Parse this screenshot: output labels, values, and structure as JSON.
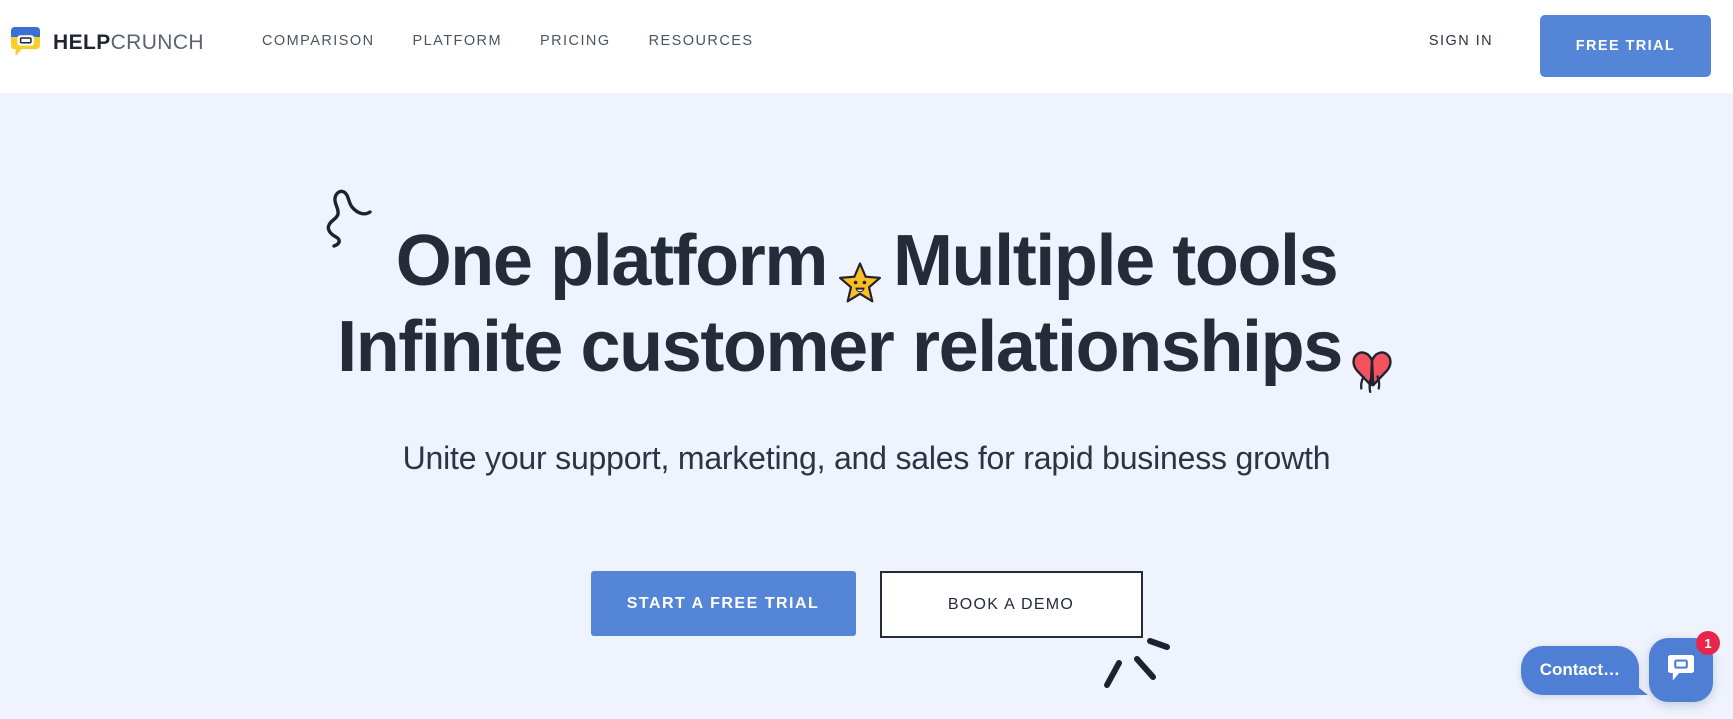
{
  "colors": {
    "accent_blue": "#5585d6",
    "chat_blue": "#4f7fd4",
    "badge_red": "#e8264b",
    "hero_bg": "#eff3fd",
    "header_bg": "#ffffff",
    "heading_dark": "#242c3a",
    "logo_blue": "#3b6fd4",
    "logo_yellow": "#f5cf2e",
    "star_yellow": "#fbbf24",
    "heart_red": "#f4525f"
  },
  "header": {
    "logo": {
      "icon": "speech-bubble-logo-icon",
      "text_bold": "HELP",
      "text_light": "CRUNCH"
    },
    "nav_items": [
      {
        "label": "COMPARISON",
        "name": "nav-item-comparison"
      },
      {
        "label": "PLATFORM",
        "name": "nav-item-platform"
      },
      {
        "label": "PRICING",
        "name": "nav-item-pricing"
      },
      {
        "label": "RESOURCES",
        "name": "nav-item-resources"
      }
    ],
    "sign_in_label": "SIGN IN",
    "free_trial_label": "FREE TRIAL"
  },
  "hero": {
    "headline_line1_before": "One platform",
    "headline_line1_emoji": "glowing-star-emoji",
    "headline_line1_after": "Multiple tools",
    "headline_line2": "Infinite customer relationships",
    "headline_line2_emoji": "beating-heart-emoji",
    "subheadline": "Unite your support, marketing, and sales for rapid business growth",
    "cta_primary_label": "START A FREE TRIAL",
    "cta_secondary_label": "BOOK A DEMO",
    "doodles": [
      {
        "name": "squiggle-doodle"
      },
      {
        "name": "sparkle-burst-doodle"
      }
    ]
  },
  "chat_widget": {
    "bubble_text": "Contact…",
    "launcher_icon": "chat-bubble-icon",
    "badge_count": "1"
  }
}
